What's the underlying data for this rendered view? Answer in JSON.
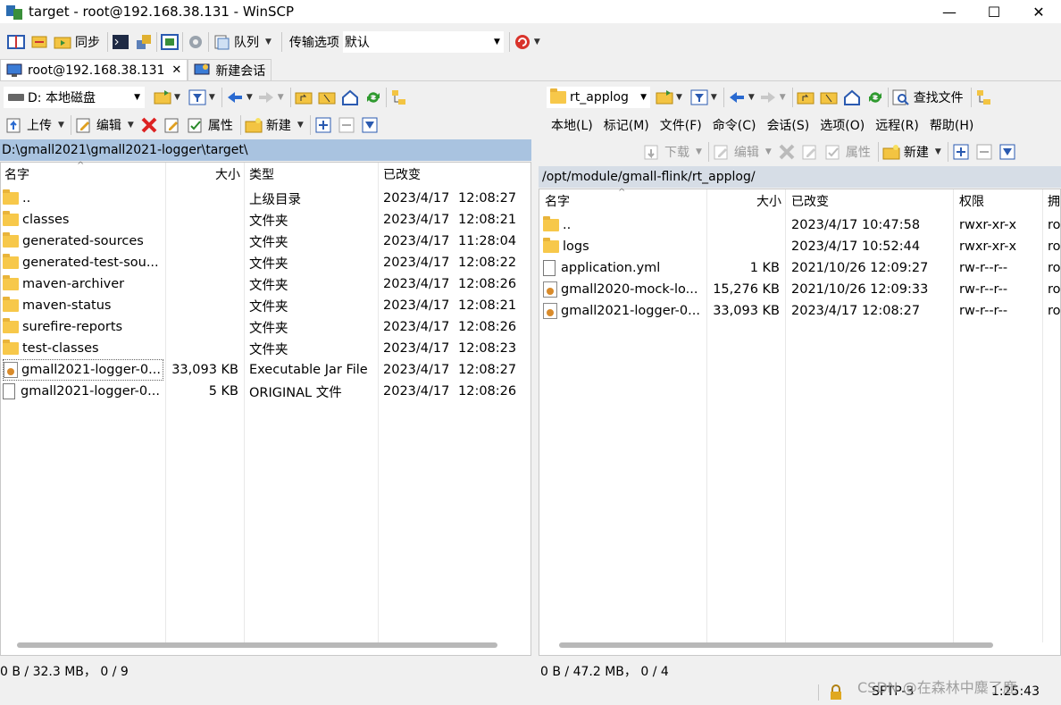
{
  "window": {
    "title": "target - root@192.168.38.131 - WinSCP"
  },
  "toolbar": {
    "sync_label": "同步",
    "queue_label": "队列",
    "transfer_label": "传输选项",
    "transfer_value": "默认"
  },
  "tabs": [
    {
      "label": "root@192.168.38.131"
    },
    {
      "label": "新建会话"
    }
  ],
  "left": {
    "drive": "D: 本地磁盘",
    "upload": "上传",
    "edit": "编辑",
    "props": "属性",
    "new": "新建",
    "path": "D:\\gmall2021\\gmall2021-logger\\target\\",
    "columns": [
      "名字",
      "大小",
      "类型",
      "已改变"
    ],
    "files": [
      {
        "name": "..",
        "size": "",
        "type": "上级目录",
        "date": "2023/4/17",
        "time": "12:08:27",
        "icon": "up"
      },
      {
        "name": "classes",
        "size": "",
        "type": "文件夹",
        "date": "2023/4/17",
        "time": "12:08:21",
        "icon": "folder"
      },
      {
        "name": "generated-sources",
        "size": "",
        "type": "文件夹",
        "date": "2023/4/17",
        "time": "11:28:04",
        "icon": "folder"
      },
      {
        "name": "generated-test-sou...",
        "size": "",
        "type": "文件夹",
        "date": "2023/4/17",
        "time": "12:08:22",
        "icon": "folder"
      },
      {
        "name": "maven-archiver",
        "size": "",
        "type": "文件夹",
        "date": "2023/4/17",
        "time": "12:08:26",
        "icon": "folder"
      },
      {
        "name": "maven-status",
        "size": "",
        "type": "文件夹",
        "date": "2023/4/17",
        "time": "12:08:21",
        "icon": "folder"
      },
      {
        "name": "surefire-reports",
        "size": "",
        "type": "文件夹",
        "date": "2023/4/17",
        "time": "12:08:26",
        "icon": "folder"
      },
      {
        "name": "test-classes",
        "size": "",
        "type": "文件夹",
        "date": "2023/4/17",
        "time": "12:08:23",
        "icon": "folder"
      },
      {
        "name": "gmall2021-logger-0...",
        "size": "33,093 KB",
        "type": "Executable Jar File",
        "date": "2023/4/17",
        "time": "12:08:27",
        "icon": "jar"
      },
      {
        "name": "gmall2021-logger-0...",
        "size": "5 KB",
        "type": "ORIGINAL 文件",
        "date": "2023/4/17",
        "time": "12:08:26",
        "icon": "file"
      }
    ],
    "status": "0 B / 32.3 MB，  0 / 9"
  },
  "right": {
    "dir": "rt_applog",
    "find": "查找文件",
    "menu": [
      "本地(L)",
      "标记(M)",
      "文件(F)",
      "命令(C)",
      "会话(S)",
      "选项(O)",
      "远程(R)",
      "帮助(H)"
    ],
    "download": "下载",
    "edit": "编辑",
    "props": "属性",
    "new": "新建",
    "path": "/opt/module/gmall-flink/rt_applog/",
    "columns": [
      "名字",
      "大小",
      "已改变",
      "权限",
      "拥"
    ],
    "files": [
      {
        "name": "..",
        "size": "",
        "date": "2023/4/17 10:47:58",
        "perm": "rwxr-xr-x",
        "owner": "ro",
        "icon": "up"
      },
      {
        "name": "logs",
        "size": "",
        "date": "2023/4/17 10:52:44",
        "perm": "rwxr-xr-x",
        "owner": "ro",
        "icon": "folder"
      },
      {
        "name": "application.yml",
        "size": "1 KB",
        "date": "2021/10/26 12:09:27",
        "perm": "rw-r--r--",
        "owner": "ro",
        "icon": "file"
      },
      {
        "name": "gmall2020-mock-lo...",
        "size": "15,276 KB",
        "date": "2021/10/26 12:09:33",
        "perm": "rw-r--r--",
        "owner": "ro",
        "icon": "jar"
      },
      {
        "name": "gmall2021-logger-0...",
        "size": "33,093 KB",
        "date": "2023/4/17 12:08:27",
        "perm": "rw-r--r--",
        "owner": "ro",
        "icon": "jar"
      }
    ],
    "status": "0 B / 47.2 MB，  0 / 4"
  },
  "bottom": {
    "protocol": "SFTP-3",
    "time": "1:25:43",
    "watermark": "CSDN @在森林中麋了鹿"
  }
}
